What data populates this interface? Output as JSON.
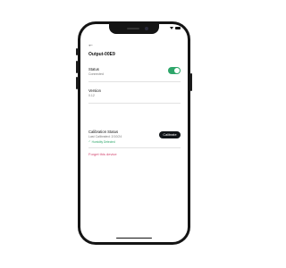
{
  "status_bar": {
    "time": "",
    "icons": [
      "wifi-icon",
      "battery-icon"
    ]
  },
  "nav": {
    "back_icon": "arrow-left-icon",
    "back_glyph": "←"
  },
  "device": {
    "title": "Output-00E9"
  },
  "status": {
    "label": "Status",
    "value": "Connected",
    "toggle_on": true
  },
  "version": {
    "label": "Version",
    "value": "0.12"
  },
  "calibration": {
    "label": "Calibration Status",
    "last": "Last Calibrated: 2/10/24",
    "badge": "Humidity Detected",
    "check_glyph": "✓",
    "button_label": "Calibrate"
  },
  "forget": {
    "label": "Forget this device"
  },
  "colors": {
    "accent_green": "#2ea66a",
    "danger_pink": "#d2456f",
    "button_dark": "#101418",
    "phone_frame": "#141414"
  }
}
